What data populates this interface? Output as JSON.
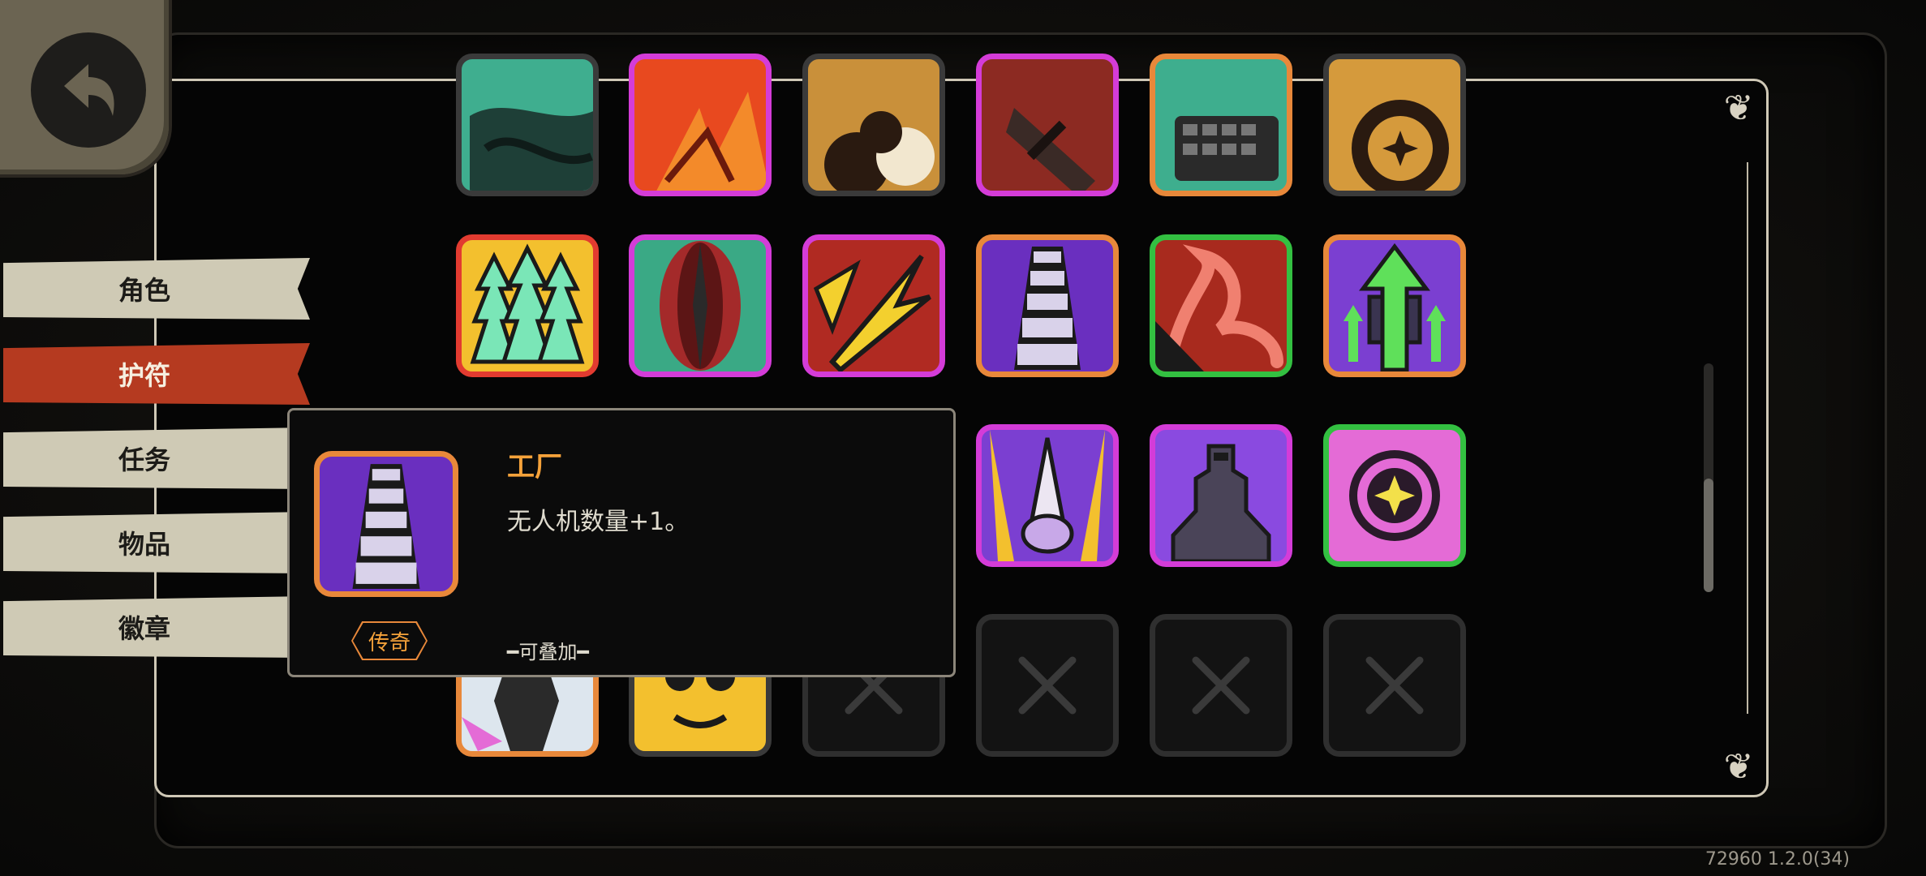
{
  "menu": {
    "items": [
      {
        "label": "角色",
        "active": false
      },
      {
        "label": "护符",
        "active": true
      },
      {
        "label": "任务",
        "active": false
      },
      {
        "label": "物品",
        "active": false
      },
      {
        "label": "徽章",
        "active": false
      }
    ]
  },
  "back_button": {
    "icon": "back-arrow-icon"
  },
  "grid": {
    "rows": [
      [
        "teal-charm",
        "fire-charm",
        "smoke-charm",
        "gun-charm",
        "keyboard-charm",
        "sun-charm"
      ],
      [
        "triple-arrow-charm",
        "blade-charm",
        "lightning-charm",
        "factory-charm",
        "tentacle-charm",
        "green-arrow-charm"
      ],
      [
        "locked",
        "locked",
        "locked",
        "drill-charm",
        "tank-charm",
        "star-orb-charm"
      ],
      [
        "figure-charm",
        "mask-charm",
        "empty",
        "empty",
        "empty",
        "empty"
      ]
    ]
  },
  "tooltip": {
    "name": "工厂",
    "description": "无人机数量+1。",
    "rarity": "传奇",
    "stack_text": "━可叠加━",
    "icon": "factory-charm-icon"
  },
  "colors": {
    "active_menu": "#b53a20",
    "menu": "#cfcab5",
    "legendary": "#e8883a",
    "epic": "#d43cd8",
    "rare": "#33c041",
    "red": "#e23b30"
  },
  "version": "72960 1.2.0(34)"
}
